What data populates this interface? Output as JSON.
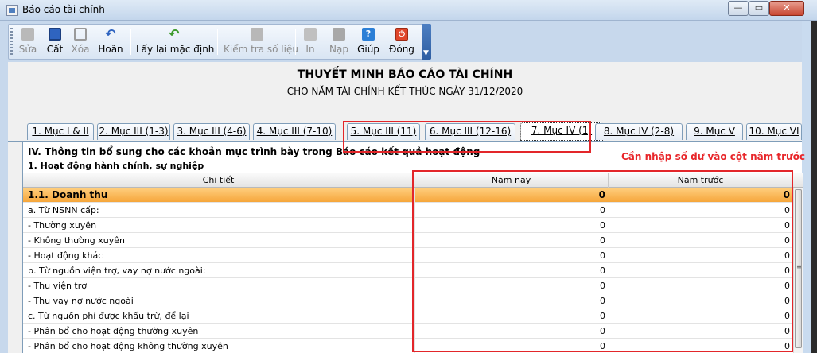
{
  "window": {
    "title": "Báo cáo tài chính",
    "min_label": "—",
    "max_label": "▭",
    "close_label": "✕"
  },
  "toolbar": {
    "buttons": [
      {
        "label": "Sửa",
        "icon": "edit-icon",
        "enabled": false
      },
      {
        "label": "Cất",
        "icon": "save-icon",
        "enabled": true
      },
      {
        "label": "Xóa",
        "icon": "delete-icon",
        "enabled": false
      },
      {
        "label": "Hoãn",
        "icon": "undo-icon",
        "enabled": true
      },
      {
        "label": "Lấy lại mặc định",
        "icon": "reload-default-icon",
        "enabled": true
      },
      {
        "label": "Kiểm tra số liệu",
        "icon": "check-data-icon",
        "enabled": false
      },
      {
        "label": "In",
        "icon": "print-icon",
        "enabled": false
      },
      {
        "label": "Nạp",
        "icon": "load-icon",
        "enabled": false
      },
      {
        "label": "Giúp",
        "icon": "help-icon",
        "enabled": true
      },
      {
        "label": "Đóng",
        "icon": "close-icon",
        "enabled": true
      }
    ]
  },
  "report": {
    "title": "THUYẾT MINH BÁO CÁO TÀI CHÍNH",
    "subtitle": "CHO NĂM TÀI CHÍNH KẾT THÚC NGÀY 31/12/2020"
  },
  "tabs": [
    {
      "label": "1. Mục I & II",
      "active": false
    },
    {
      "label": "2. Mục III (1-3)",
      "active": false
    },
    {
      "label": "3. Mục III (4-6)",
      "active": false
    },
    {
      "label": "4. Mục III (7-10)",
      "active": false
    },
    {
      "label": "5. Mục III (11)",
      "active": false
    },
    {
      "label": "6. Mục III (12-16)",
      "active": false
    },
    {
      "label": "7. Mục IV (1)",
      "active": true
    },
    {
      "label": "8. Mục IV (2-8)",
      "active": false
    },
    {
      "label": "9. Mục V",
      "active": false
    },
    {
      "label": "10. Mục VI",
      "active": false
    }
  ],
  "section": {
    "heading": "IV. Thông tin bổ sung cho các khoản mục trình bày trong Báo cáo kết quả hoạt động",
    "subheading": "1. Hoạt động hành chính, sự nghiệp",
    "annotation": "Cần nhập số dư vào cột năm trước"
  },
  "grid": {
    "columns": [
      "Chi tiết",
      "Năm nay",
      "Năm trước"
    ],
    "rows": [
      {
        "detail": "1.1. Doanh thu",
        "current": "0",
        "previous": "0",
        "highlight": true
      },
      {
        "detail": "a. Từ NSNN cấp:",
        "current": "0",
        "previous": "0"
      },
      {
        "detail": "- Thường xuyên",
        "current": "0",
        "previous": "0"
      },
      {
        "detail": "- Không thường xuyên",
        "current": "0",
        "previous": "0"
      },
      {
        "detail": "- Hoạt động khác",
        "current": "0",
        "previous": "0"
      },
      {
        "detail": "b. Từ nguồn viện trợ, vay nợ nước ngoài:",
        "current": "0",
        "previous": "0"
      },
      {
        "detail": "- Thu viện trợ",
        "current": "0",
        "previous": "0"
      },
      {
        "detail": "- Thu vay nợ nước ngoài",
        "current": "0",
        "previous": "0"
      },
      {
        "detail": "c. Từ nguồn phí được khấu trừ, để lại",
        "current": "0",
        "previous": "0"
      },
      {
        "detail": "- Phân bổ cho hoạt động thường xuyên",
        "current": "0",
        "previous": "0"
      },
      {
        "detail": "- Phân bổ cho hoạt động không thường xuyên",
        "current": "0",
        "previous": "0"
      }
    ],
    "scroll_grip": "≡"
  },
  "colors": {
    "highlight_row": "#f6a63a",
    "annotation": "#e8262a",
    "callout_box": "#e3262a"
  }
}
